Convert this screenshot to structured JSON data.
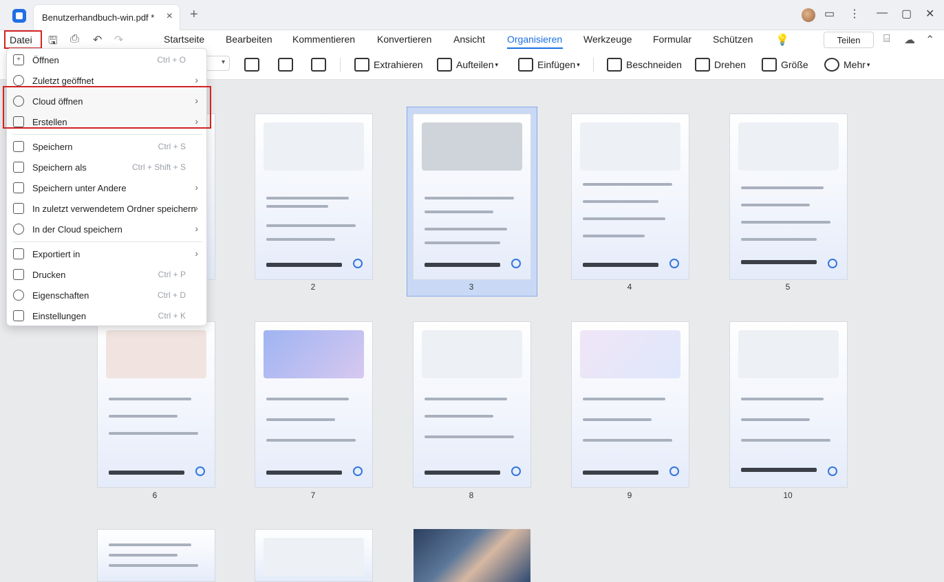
{
  "titlebar": {
    "tab_title": "Benutzerhandbuch-win.pdf *",
    "close_glyph": "×",
    "new_tab_glyph": "+"
  },
  "menubar": {
    "file_label": "Datei",
    "tabs": [
      "Startseite",
      "Bearbeiten",
      "Kommentieren",
      "Konvertieren",
      "Ansicht",
      "Organisieren",
      "Werkzeuge",
      "Formular",
      "Schützen"
    ],
    "active_tab": "Organisieren",
    "share_label": "Teilen"
  },
  "toolbar": {
    "extract": "Extrahieren",
    "split": "Aufteilen",
    "insert": "Einfügen",
    "crop": "Beschneiden",
    "rotate": "Drehen",
    "size": "Größe",
    "more": "Mehr"
  },
  "file_menu": {
    "items": [
      {
        "label": "Öffnen",
        "shortcut": "Ctrl + O",
        "submenu": false,
        "icon": "plus-square-icon"
      },
      {
        "label": "Zuletzt geöffnet",
        "shortcut": "",
        "submenu": true,
        "icon": "clock-icon"
      },
      {
        "label": "Cloud öffnen",
        "shortcut": "",
        "submenu": true,
        "icon": "cloud-icon"
      },
      {
        "label": "Erstellen",
        "shortcut": "",
        "submenu": true,
        "icon": "folder-icon"
      },
      {
        "label": "Speichern",
        "shortcut": "Ctrl + S",
        "submenu": false,
        "icon": "save-icon"
      },
      {
        "label": "Speichern als",
        "shortcut": "Ctrl + Shift + S",
        "submenu": false,
        "icon": "save-as-icon"
      },
      {
        "label": "Speichern unter Andere",
        "shortcut": "",
        "submenu": true,
        "icon": "save-other-icon"
      },
      {
        "label": "In zuletzt verwendetem Ordner speichern",
        "shortcut": "",
        "submenu": true,
        "icon": "folder-icon"
      },
      {
        "label": "In der Cloud speichern",
        "shortcut": "",
        "submenu": true,
        "icon": "cloud-icon"
      },
      {
        "label": "Exportiert in",
        "shortcut": "",
        "submenu": true,
        "icon": "export-icon"
      },
      {
        "label": "Drucken",
        "shortcut": "Ctrl + P",
        "submenu": false,
        "icon": "print-icon"
      },
      {
        "label": "Eigenschaften",
        "shortcut": "Ctrl + D",
        "submenu": false,
        "icon": "properties-icon"
      },
      {
        "label": "Einstellungen",
        "shortcut": "Ctrl + K",
        "submenu": false,
        "icon": "settings-icon"
      }
    ]
  },
  "pages": {
    "numbers": [
      "2",
      "3",
      "4",
      "5",
      "6",
      "7",
      "8",
      "9",
      "10"
    ],
    "selected": "3"
  },
  "colors": {
    "accent": "#1a6fe2",
    "highlight_red": "#d32222",
    "selection": "#c9d9f5"
  }
}
